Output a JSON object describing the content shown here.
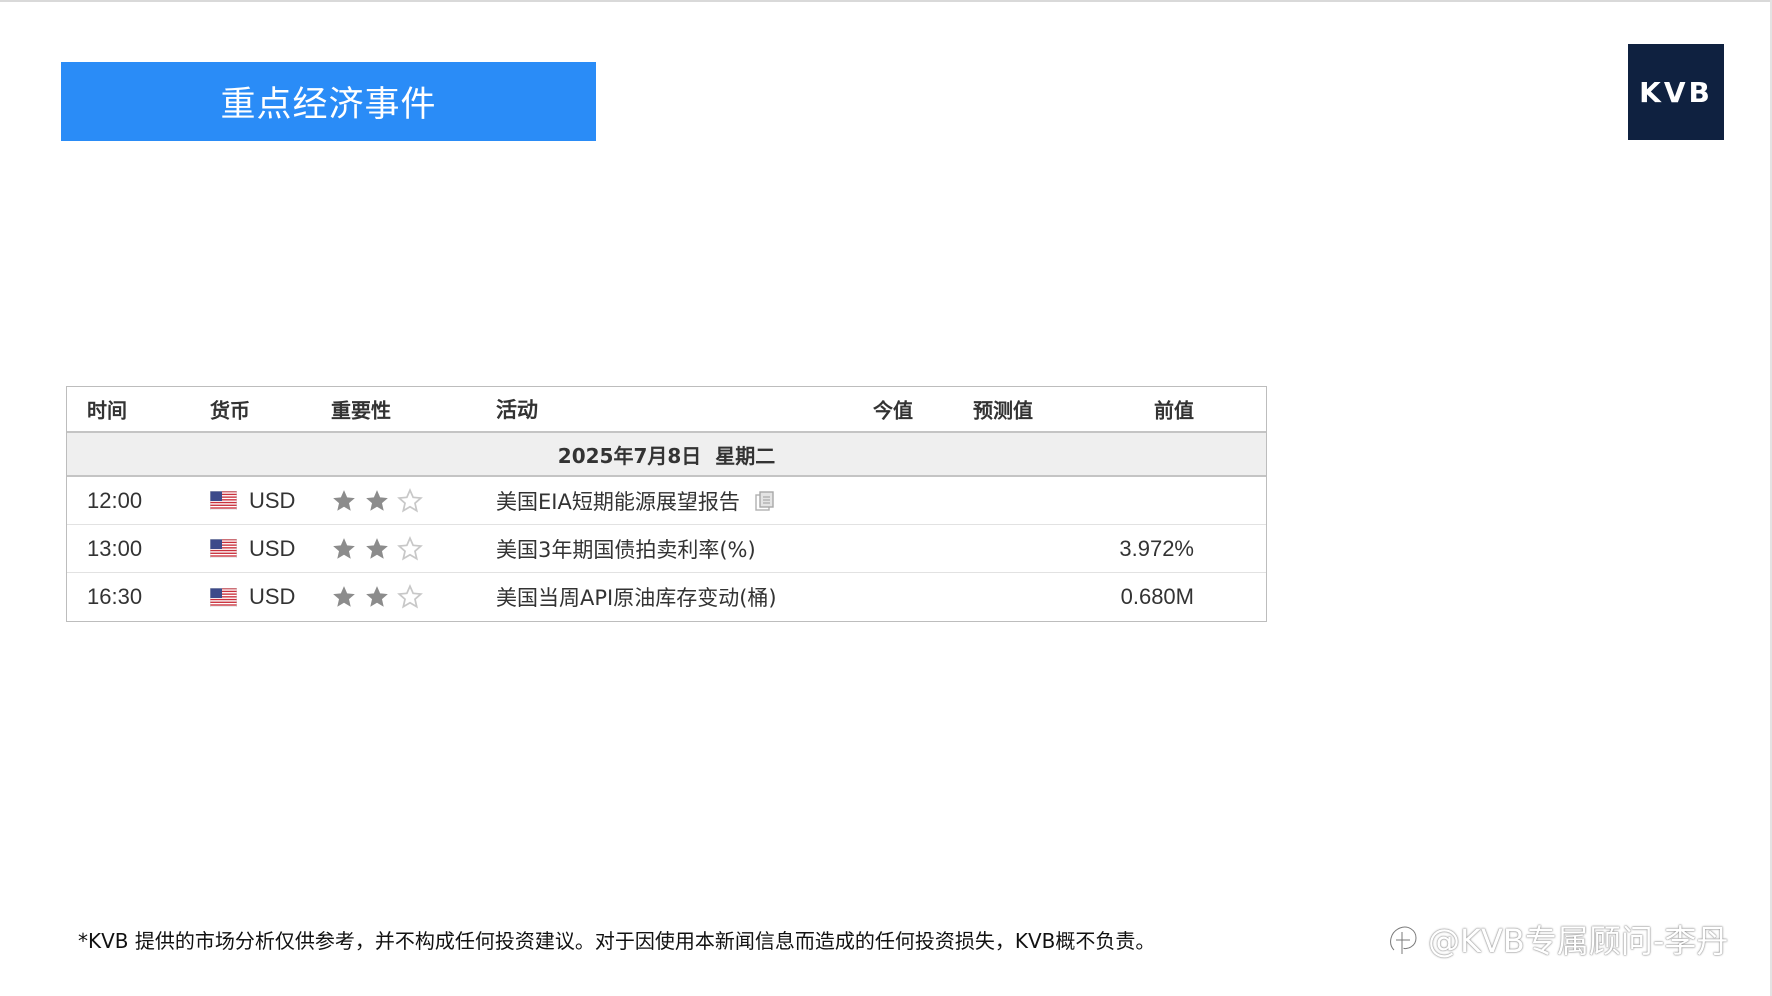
{
  "title_banner": "重点经济事件",
  "logo_text": "KVB",
  "colors": {
    "banner": "#2a8cf7",
    "logo_bg": "#0f2140",
    "date_row_bg": "#efefef",
    "star_filled": "#8c8c8c",
    "star_empty": "#c8c8c8"
  },
  "calendar": {
    "headers": {
      "time": "时间",
      "currency": "货币",
      "importance": "重要性",
      "activity": "活动",
      "actual": "今值",
      "forecast": "预测值",
      "previous": "前值"
    },
    "date_label": "2025年7月8日  星期二",
    "rows": [
      {
        "time": "12:00",
        "currency": "USD",
        "flag_icon": "us-flag-icon",
        "importance": 2,
        "importance_max": 3,
        "activity": "美国EIA短期能源展望报告",
        "has_doc_icon": true,
        "actual": "",
        "forecast": "",
        "previous": ""
      },
      {
        "time": "13:00",
        "currency": "USD",
        "flag_icon": "us-flag-icon",
        "importance": 2,
        "importance_max": 3,
        "activity": "美国3年期国债拍卖利率(%)",
        "has_doc_icon": false,
        "actual": "",
        "forecast": "",
        "previous": "3.972%"
      },
      {
        "time": "16:30",
        "currency": "USD",
        "flag_icon": "us-flag-icon",
        "importance": 2,
        "importance_max": 3,
        "activity": "美国当周API原油库存变动(桶)",
        "has_doc_icon": false,
        "actual": "",
        "forecast": "",
        "previous": "0.680M"
      }
    ]
  },
  "disclaimer": "*KVB 提供的市场分析仅供参考，并不构成任何投资建议。对于因使用本新闻信息而造成的任何投资损失，KVB概不负责。",
  "watermark": "@KVB专属顾问-李丹"
}
